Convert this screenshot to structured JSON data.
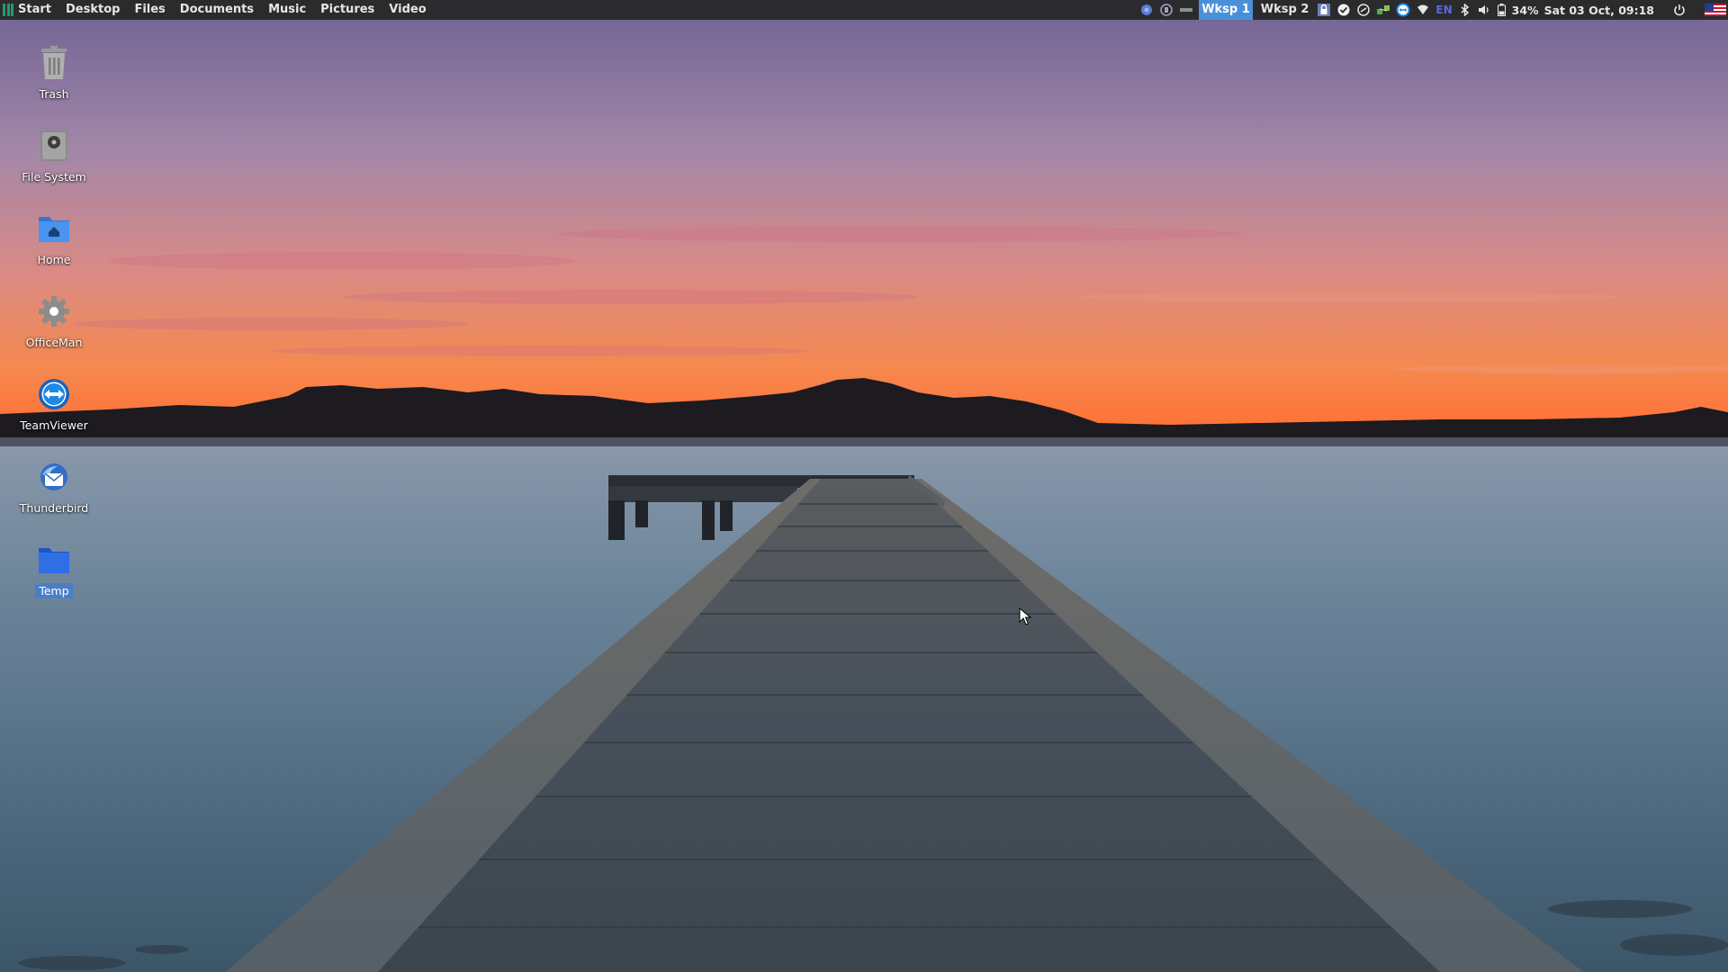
{
  "panel": {
    "menu": [
      {
        "id": "start",
        "label": "Start"
      },
      {
        "id": "desktop",
        "label": "Desktop"
      },
      {
        "id": "files",
        "label": "Files"
      },
      {
        "id": "documents",
        "label": "Documents"
      },
      {
        "id": "music",
        "label": "Music"
      },
      {
        "id": "pictures",
        "label": "Pictures"
      },
      {
        "id": "video",
        "label": "Video"
      }
    ],
    "workspaces": [
      {
        "label": "Wksp 1",
        "active": true
      },
      {
        "label": "Wksp 2",
        "active": false
      }
    ],
    "keyboard_layout": "EN",
    "battery": "34%",
    "clock": "Sat 03 Oct, 09:18",
    "tray_icons": [
      "chromium-icon",
      "clipboard-icon",
      "minimize-icon",
      "lock-icon",
      "checkmark-icon",
      "update-icon",
      "network-manager-icon",
      "teamviewer-tray-icon",
      "wifi-icon",
      "bluetooth-icon",
      "volume-icon",
      "battery-icon",
      "power-icon",
      "us-flag-icon"
    ]
  },
  "desktop": {
    "icons": [
      {
        "label": "Trash",
        "icon": "trash-icon"
      },
      {
        "label": "File System",
        "icon": "filesystem-icon"
      },
      {
        "label": "Home",
        "icon": "home-folder-icon"
      },
      {
        "label": "OfficeMan",
        "icon": "gear-icon"
      },
      {
        "label": "TeamViewer",
        "icon": "teamviewer-icon"
      },
      {
        "label": "Thunderbird",
        "icon": "thunderbird-icon"
      },
      {
        "label": "Temp",
        "icon": "folder-icon",
        "selected": true
      }
    ]
  },
  "colors": {
    "panel_bg": "#2b2b2e",
    "workspace_active": "#4a90d9",
    "selection": "#4a7fc8",
    "sky_top": "#7f6e9e",
    "sky_horizon": "#ff7a3c",
    "water": "#5f7a8e"
  }
}
